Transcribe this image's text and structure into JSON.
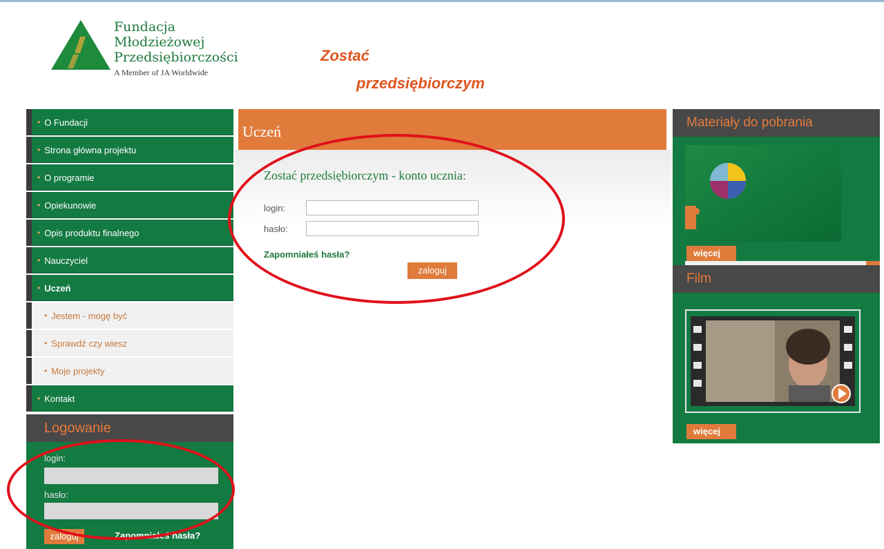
{
  "header": {
    "logo_lines": [
      "Fundacja",
      "Młodzieżowej",
      "Przedsiębiorczości"
    ],
    "logo_member": "A Member of JA Worldwide",
    "tagline_1": "Zostać",
    "tagline_2": "przedsiębiorczym"
  },
  "nav": {
    "items": [
      {
        "label": "O Fundacji"
      },
      {
        "label": "Strona główna projektu"
      },
      {
        "label": "O programie"
      },
      {
        "label": "Opiekunowie"
      },
      {
        "label": "Opis produktu finalnego"
      },
      {
        "label": "Nauczyciel"
      },
      {
        "label": "Uczeń"
      }
    ],
    "subitems": [
      {
        "label": "Jestem - mogę być"
      },
      {
        "label": "Sprawdź czy wiesz"
      },
      {
        "label": "Moje projekty"
      }
    ],
    "contact": "Kontakt"
  },
  "login_box": {
    "title": "Logowanie",
    "login_label": "login:",
    "password_label": "hasło:",
    "login_value": "",
    "password_value": "",
    "button": "zaloguj",
    "forgot": "Zapomniałeś hasła?"
  },
  "main": {
    "title": "Uczeń",
    "form_title": "Zostać przedsiębiorczym - konto ucznia:",
    "login_label": "login:",
    "password_label": "hasło:",
    "login_value": "",
    "password_value": "",
    "forgot": "Zapomniałeś hasła?",
    "button": "zaloguj"
  },
  "right": {
    "downloads_title": "Materiały do pobrania",
    "downloads_more": "więcej",
    "film_title": "Film",
    "film_more": "więcej"
  },
  "colors": {
    "green": "#137a42",
    "orange": "#e07b3c",
    "dark": "#484848",
    "annotation_red": "#e0101a"
  }
}
